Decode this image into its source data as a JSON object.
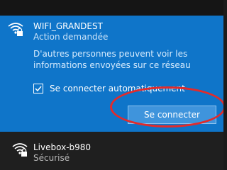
{
  "selected_network": {
    "name": "WIFI_GRANDEST",
    "status": "Action demandée",
    "info": "D'autres personnes peuvent voir les informations envoyées sur ce réseau",
    "auto_connect_label": "Se connecter automatiquement",
    "auto_connect_checked": true,
    "connect_button_label": "Se connecter",
    "icon": "wifi-secured-warning-icon"
  },
  "other_networks": [
    {
      "name": "Livebox-b980",
      "status": "Sécurisé",
      "icon": "wifi-secured-icon"
    }
  ],
  "colors": {
    "selected_bg": "#0f75c9",
    "button_bg": "#3f94dc",
    "highlight": "#e22b2b",
    "list_bg": "#1f1f1f"
  }
}
